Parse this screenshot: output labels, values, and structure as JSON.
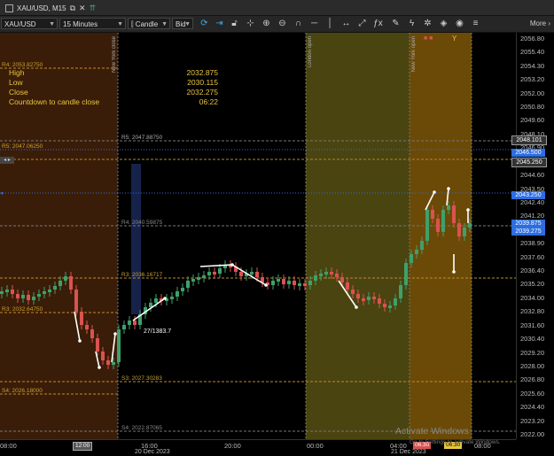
{
  "tab": {
    "title": "XAU/USD, M15",
    "icons": [
      "popout-icon",
      "close-icon",
      "add-chart-icon"
    ]
  },
  "toolbar": {
    "symbol": "XAU/USD",
    "timeframe": "15 Minutes",
    "chart_type": "Candle",
    "price_type": "Bid",
    "more_label": "More"
  },
  "info": {
    "high_label": "High",
    "high_value": "2032.875",
    "low_label": "Low",
    "low_value": "2030.115",
    "close_label": "Close",
    "close_value": "2032.275",
    "countdown_label": "Countdown to candle close",
    "countdown_value": "06:22"
  },
  "levels": {
    "r5": "R5: 2047.88750",
    "r5_left": "R5: 2047.06250",
    "r4": "R4: 2040.59875",
    "r3": "R3: 2036.16717",
    "r3_left": "R3: 2032.64750",
    "s3": "S3: 2027.30283",
    "s4": "S4: 2022.87065",
    "s4_left": "S4: 2026.18000",
    "left_top": "R4: 2053.82750"
  },
  "sessions": {
    "ny": "New York close",
    "london": "London open",
    "ny_open": "New York open"
  },
  "annotation": "27/1383.7",
  "y_ticks": [
    "2056.80",
    "2055.40",
    "2054.30",
    "2053.20",
    "2052.00",
    "2050.80",
    "2049.60",
    "2048.10",
    "2046.90",
    "2045.80",
    "2044.60",
    "2043.50",
    "2042.40",
    "2041.20",
    "2040.10",
    "2038.90",
    "2037.60",
    "2036.40",
    "2035.20",
    "2034.00",
    "2032.80",
    "2031.60",
    "2030.40",
    "2029.20",
    "2028.00",
    "2026.80",
    "2025.60",
    "2024.40",
    "2023.20",
    "2022.00"
  ],
  "y_flags": {
    "top": "2048.101",
    "blue1": "2046.500",
    "amber": "2045.250",
    "blue2": "2043.250",
    "cur_a": "2039.875",
    "cur_b": "2039.275"
  },
  "x_ticks": {
    "t1": "08:00",
    "t2": "12:00",
    "t3": "16:00",
    "t4": "20:00",
    "t5": "00:00",
    "t6": "04:00",
    "t7": "08:00"
  },
  "x_dates": {
    "d1": "20 Dec 2023",
    "d2": "21 Dec 2023"
  },
  "x_flags": {
    "f1": "12:00",
    "f2": "06:30",
    "f3": "06:30"
  },
  "watermark": {
    "line1": "Activate Windows",
    "line2": "Go to Settings to activate Windows."
  },
  "colors": {
    "bull": "#3fa06a",
    "bear": "#d9534f",
    "session_brown": "#3a1d08",
    "session_olive": "#4a4410",
    "session_amber": "#6b4a07",
    "info_text": "#e8c640"
  }
}
